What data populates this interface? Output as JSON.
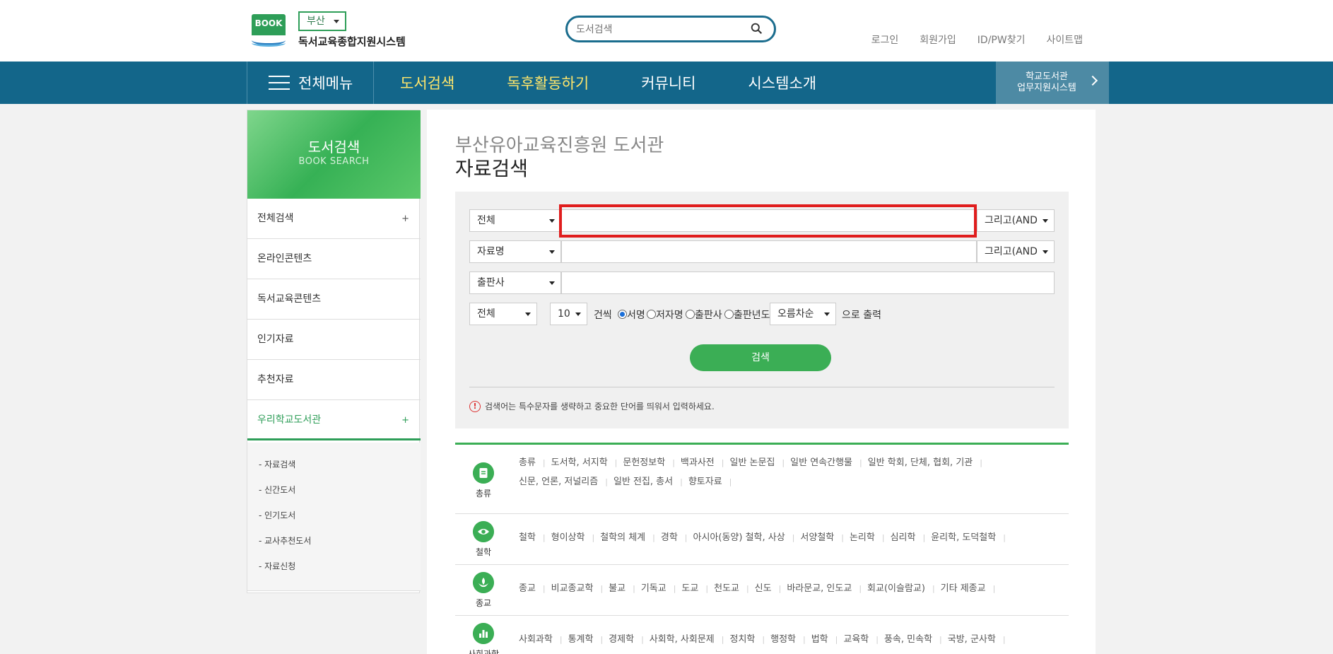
{
  "header": {
    "logo_badge": "BOOK",
    "region": "부산",
    "site_title": "독서교육종합지원시스템",
    "search_placeholder": "도서검색",
    "util_links": [
      "로그인",
      "회원가입",
      "ID/PW찾기",
      "사이트맵"
    ]
  },
  "gnb": {
    "all_menu": "전체메뉴",
    "items": [
      {
        "label": "도서검색",
        "highlight": true
      },
      {
        "label": "독후활동하기",
        "highlight": true
      },
      {
        "label": "커뮤니티",
        "highlight": false
      },
      {
        "label": "시스템소개",
        "highlight": false
      }
    ],
    "school_line1": "학교도서관",
    "school_line2": "업무지원시스템"
  },
  "sidebar": {
    "banner_title": "도서검색",
    "banner_subtitle": "BOOK SEARCH",
    "items": [
      {
        "label": "전체검색",
        "plus": "+"
      },
      {
        "label": "온라인콘텐츠",
        "plus": ""
      },
      {
        "label": "독서교육콘텐츠",
        "plus": ""
      },
      {
        "label": "인기자료",
        "plus": ""
      },
      {
        "label": "추천자료",
        "plus": ""
      },
      {
        "label": "우리학교도서관",
        "plus": "+"
      }
    ],
    "sub_items": [
      "- 자료검색",
      "- 신간도서",
      "- 인기도서",
      "- 교사추천도서",
      "- 자료신청"
    ]
  },
  "main": {
    "org_title": "부산유아교육진흥원 도서관",
    "page_title": "자료검색",
    "search": {
      "row1_field": "전체",
      "row1_op": "그리고(AND",
      "row2_field": "자료명",
      "row2_op": "그리고(AND",
      "row3_field": "출판사",
      "filter_all": "전체",
      "count": "10",
      "count_suffix": "건씩",
      "sort_options": [
        "서명",
        "저자명",
        "출판사",
        "출판년도"
      ],
      "order": "오름차순",
      "output_suffix": "으로 출력",
      "search_button": "검색",
      "notice_icon": "!",
      "notice": "검색어는 특수문자를 생략하고 중요한 단어를 띄워서 입력하세요."
    },
    "categories": [
      {
        "label": "총류",
        "icon": "document-icon",
        "links": [
          "총류",
          "도서학, 서지학",
          "문헌정보학",
          "백과사전",
          "일반 논문집",
          "일반 연속간행물",
          "일반 학회, 단체, 협회, 기관",
          "신문, 언론, 저널리즘",
          "일반 전집, 총서",
          "향토자료"
        ]
      },
      {
        "label": "철학",
        "icon": "eye-icon",
        "links": [
          "철학",
          "형이상학",
          "철학의 체계",
          "경학",
          "아시아(동양) 철학, 사상",
          "서양철학",
          "논리학",
          "심리학",
          "윤리학, 도덕철학"
        ]
      },
      {
        "label": "종교",
        "icon": "lotus-icon",
        "links": [
          "종교",
          "비교종교학",
          "불교",
          "기독교",
          "도교",
          "천도교",
          "신도",
          "바라문교, 인도교",
          "회교(이슬람교)",
          "기타 제종교"
        ]
      },
      {
        "label": "사회과학",
        "icon": "bar-chart-icon",
        "links": [
          "사회과학",
          "통계학",
          "경제학",
          "사회학, 사회문제",
          "정치학",
          "행정학",
          "법학",
          "교육학",
          "풍속, 민속학",
          "국방, 군사학"
        ]
      }
    ]
  }
}
